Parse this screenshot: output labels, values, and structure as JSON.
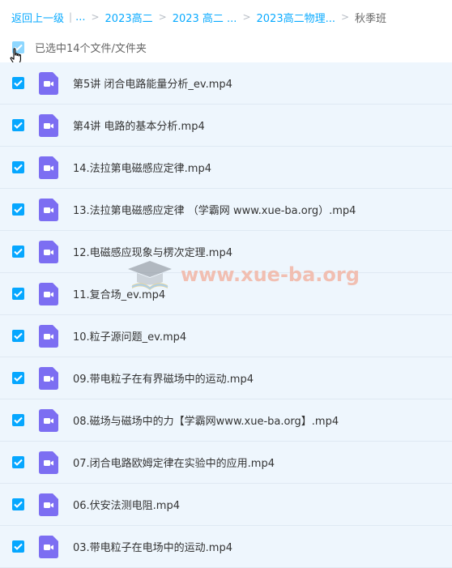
{
  "breadcrumb": {
    "back": "返回上一级",
    "sep": "|",
    "items": [
      "...",
      "2023高二",
      "2023 高二 ...",
      "2023高二物理..."
    ],
    "current": "秋季班"
  },
  "selection": {
    "label": "已选中14个文件/文件夹"
  },
  "files": [
    "第5讲 闭合电路能量分析_ev.mp4",
    "第4讲 电路的基本分析.mp4",
    "14.法拉第电磁感应定律.mp4",
    "13.法拉第电磁感应定律 （学霸网 www.xue-ba.org）.mp4",
    "12.电磁感应现象与楞次定理.mp4",
    "11.复合场_ev.mp4",
    "10.粒子源问题_ev.mp4",
    "09.带电粒子在有界磁场中的运动.mp4",
    "08.磁场与磁场中的力【学霸网www.xue-ba.org】.mp4",
    "07.闭合电路欧姆定律在实验中的应用.mp4",
    "06.伏安法测电阻.mp4",
    "03.带电粒子在电场中的运动.mp4"
  ],
  "watermark": {
    "text": "www.xue-ba.org"
  },
  "colors": {
    "accent": "#06a7ff",
    "row_bg": "#eef6fd",
    "video_icon": "#7c6ef2"
  },
  "icons": {
    "checkbox": "checkmark-icon",
    "file": "video-file-icon",
    "cursor": "hand-pointer-icon"
  }
}
